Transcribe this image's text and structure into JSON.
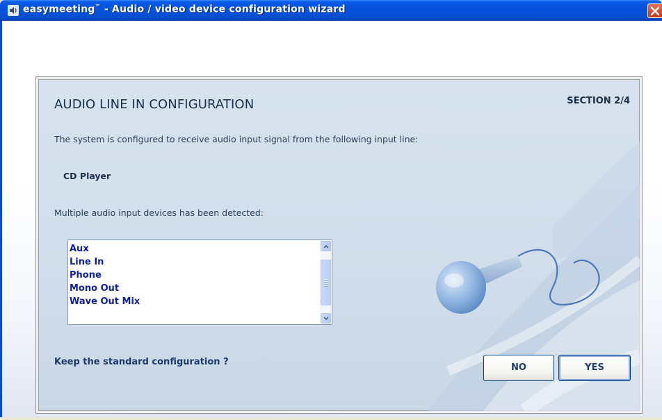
{
  "window": {
    "title_brand": "easymeeting",
    "title_tm": "™",
    "title_rest": " - Audio / video device configuration wizard",
    "icons": {
      "app": "speaker-app-icon",
      "close": "close-icon"
    }
  },
  "panel": {
    "heading": "AUDIO LINE IN CONFIGURATION",
    "section": "SECTION 2/4",
    "description": "The system is configured to receive audio input signal from the following input line:",
    "current_line": "CD Player",
    "detected_text": "Multiple audio input devices has been detected:",
    "devices": [
      "Aux",
      "Line In",
      "Phone",
      "Mono Out",
      "Wave Out Mix"
    ],
    "question": "Keep the standard configuration ?",
    "buttons": {
      "no": "NO",
      "yes": "YES"
    },
    "decoration": "microphone-illustration"
  },
  "colors": {
    "titlebar": "#0653dc",
    "panel_bg": "#d2deeb",
    "text_dark": "#1a2f4a",
    "list_text": "#10209a",
    "button_border": "#003c74"
  }
}
